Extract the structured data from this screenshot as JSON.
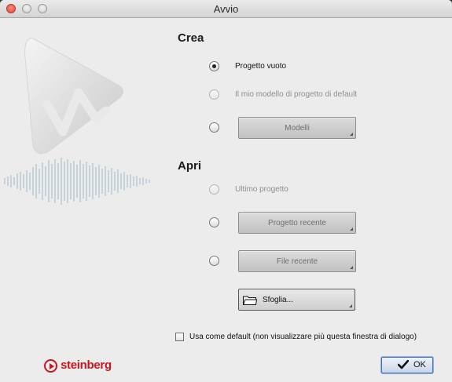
{
  "window": {
    "title": "Avvio"
  },
  "create": {
    "heading": "Crea",
    "option_empty": "Progetto vuoto",
    "option_template": "Il mio modello di progetto di default",
    "templates_button": "Modelli"
  },
  "open": {
    "heading": "Apri",
    "option_last": "Ultimo progetto",
    "recent_project_button": "Progetto recente",
    "recent_file_button": "File recente",
    "browse_button": "Sfoglia..."
  },
  "footer": {
    "default_checkbox_label": "Usa come default (non visualizzare più questa finestra di dialogo)",
    "brand": "steinberg",
    "ok_label": "OK"
  },
  "colors": {
    "brand_red": "#c8151f",
    "window_bg": "#ececec",
    "accent_blue": "#4a6fa5"
  },
  "icons": [
    "close-icon",
    "minimize-icon",
    "zoom-icon",
    "folder-icon",
    "dropdown-corner-icon",
    "checkmark-icon",
    "steinberg-logo-icon"
  ]
}
